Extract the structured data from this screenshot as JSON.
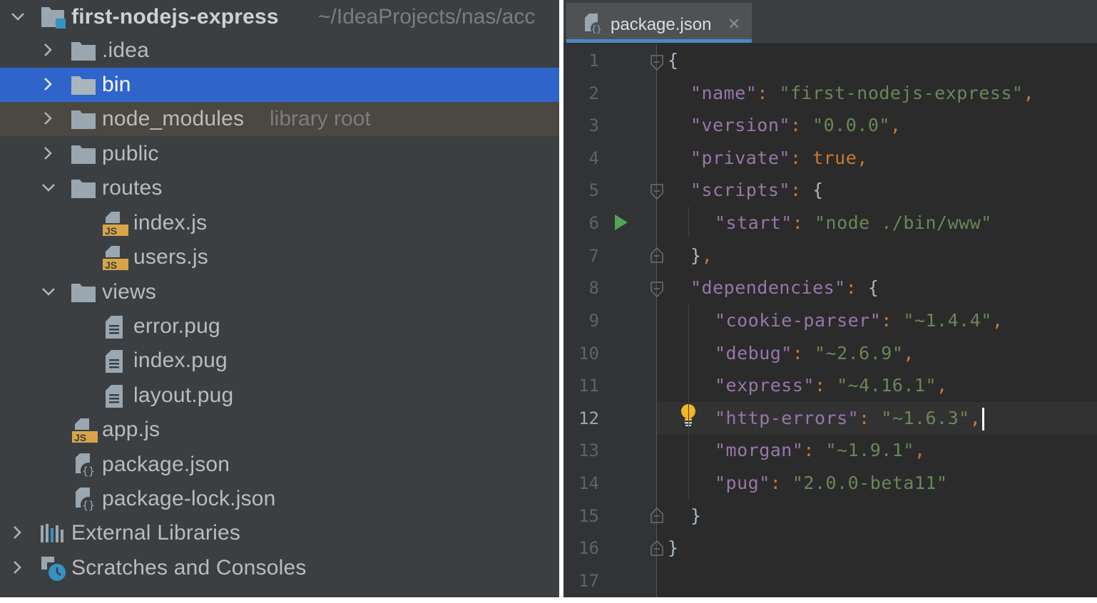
{
  "project_tree": {
    "root": {
      "name": "first-nodejs-express",
      "path": "~/IdeaProjects/nas/acc"
    },
    "items": [
      {
        "label": ".idea",
        "hint": ""
      },
      {
        "label": "bin",
        "hint": ""
      },
      {
        "label": "node_modules",
        "hint": "library root"
      },
      {
        "label": "public",
        "hint": ""
      },
      {
        "label": "routes",
        "hint": ""
      },
      {
        "label": "index.js",
        "hint": ""
      },
      {
        "label": "users.js",
        "hint": ""
      },
      {
        "label": "views",
        "hint": ""
      },
      {
        "label": "error.pug",
        "hint": ""
      },
      {
        "label": "index.pug",
        "hint": ""
      },
      {
        "label": "layout.pug",
        "hint": ""
      },
      {
        "label": "app.js",
        "hint": ""
      },
      {
        "label": "package.json",
        "hint": ""
      },
      {
        "label": "package-lock.json",
        "hint": ""
      },
      {
        "label": "External Libraries",
        "hint": ""
      },
      {
        "label": "Scratches and Consoles",
        "hint": ""
      }
    ],
    "selected": "bin"
  },
  "editor": {
    "tab": {
      "label": "package.json",
      "close": "✕"
    },
    "line_numbers": [
      "1",
      "2",
      "3",
      "4",
      "5",
      "6",
      "7",
      "8",
      "9",
      "10",
      "11",
      "12",
      "13",
      "14",
      "15",
      "16",
      "17"
    ],
    "current_line": "12",
    "code": {
      "l1": {
        "open": "{"
      },
      "l2": {
        "key": "\"name\"",
        "colon": ": ",
        "value": "\"first-nodejs-express\"",
        "comma": ","
      },
      "l3": {
        "key": "\"version\"",
        "colon": ": ",
        "value": "\"0.0.0\"",
        "comma": ","
      },
      "l4": {
        "key": "\"private\"",
        "colon": ": ",
        "value": "true",
        "comma": ","
      },
      "l5": {
        "key": "\"scripts\"",
        "colon": ": ",
        "brace": "{"
      },
      "l6": {
        "key": "\"start\"",
        "colon": ": ",
        "value": "\"node ./bin/www\""
      },
      "l7": {
        "brace": "}",
        "comma": ","
      },
      "l8": {
        "key": "\"dependencies\"",
        "colon": ": ",
        "brace": "{"
      },
      "l9": {
        "key": "\"cookie-parser\"",
        "colon": ": ",
        "value": "\"~1.4.4\"",
        "comma": ","
      },
      "l10": {
        "key": "\"debug\"",
        "colon": ": ",
        "value": "\"~2.6.9\"",
        "comma": ","
      },
      "l11": {
        "key": "\"express\"",
        "colon": ": ",
        "value": "\"~4.16.1\"",
        "comma": ","
      },
      "l12": {
        "key": "\"http-errors\"",
        "colon": ": ",
        "value": "\"~1.6.3\"",
        "comma": ","
      },
      "l13": {
        "key": "\"morgan\"",
        "colon": ": ",
        "value": "\"~1.9.1\"",
        "comma": ","
      },
      "l14": {
        "key": "\"pug\"",
        "colon": ": ",
        "value": "\"2.0.0-beta11\""
      },
      "l15": {
        "brace": "}"
      },
      "l16": {
        "close": "}"
      }
    }
  },
  "colors": {
    "panel_bg": "#3c3f41",
    "selection": "#2f65ca",
    "editor_bg": "#2b2b2b",
    "json_key": "#9876aa",
    "json_string": "#6a8759",
    "keyword": "#cc7832",
    "tab_underline": "#4a88c7"
  },
  "icons": [
    "chevron-right-icon",
    "chevron-down-icon",
    "folder-icon",
    "js-file-icon",
    "pug-file-icon",
    "json-file-icon",
    "libraries-icon",
    "scratches-icon",
    "run-icon",
    "lightbulb-icon",
    "fold-icon"
  ]
}
